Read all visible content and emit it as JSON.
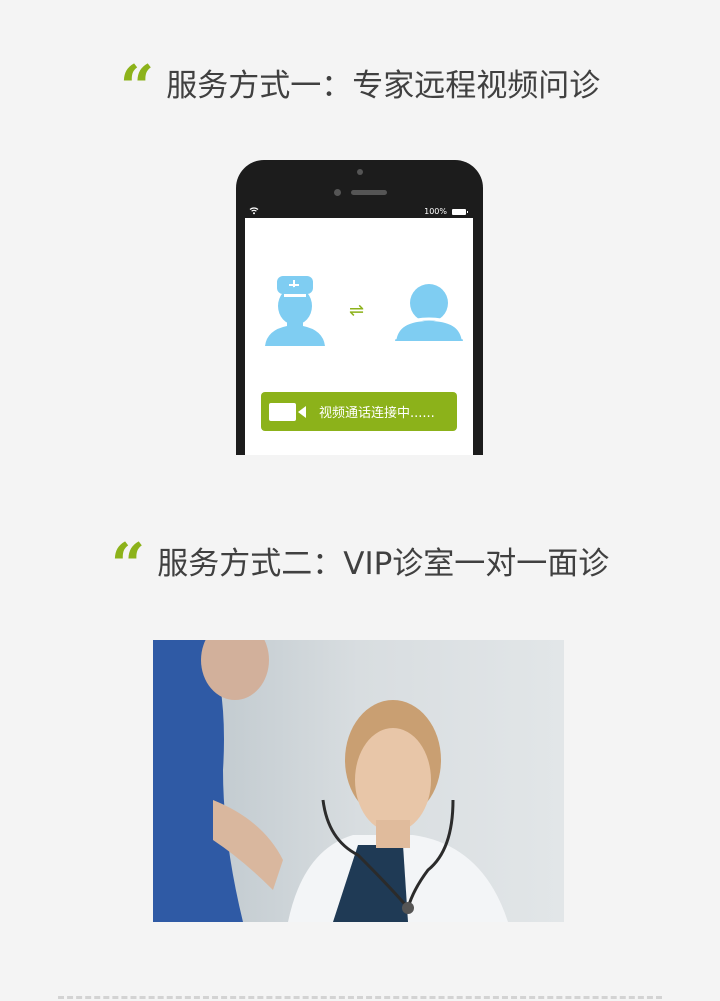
{
  "section1": {
    "quote_mark": "“",
    "heading": "服务方式一：专家远程视频问诊"
  },
  "phone": {
    "battery_text": "100%",
    "wifi_icon": "wifi-icon",
    "swap_icon": "swap-arrows-icon",
    "call_button_label": "视频通话连接中......"
  },
  "section2": {
    "quote_mark": "“",
    "heading": "服务方式二：VIP诊室一对一面诊"
  },
  "colors": {
    "accent": "#8cb21a",
    "icon_blue": "#7fcdf2",
    "background": "#f4f4f4",
    "heading_text": "#404040"
  }
}
